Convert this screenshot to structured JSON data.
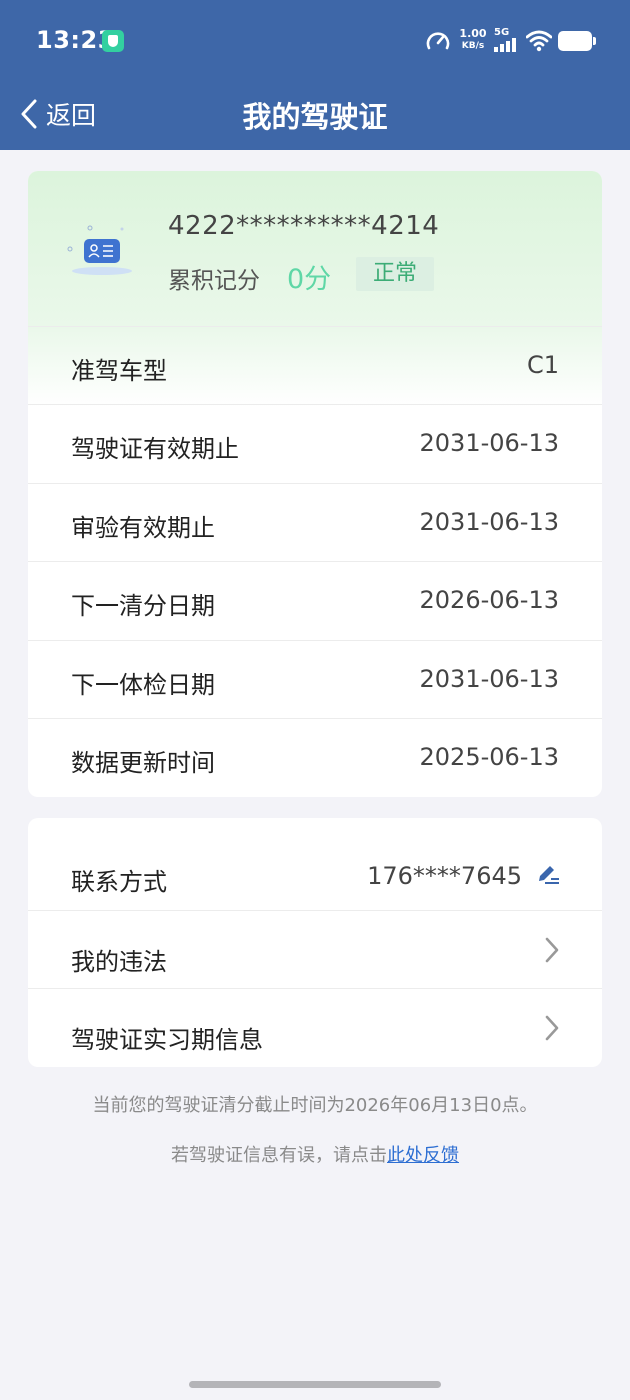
{
  "status_bar": {
    "time": "13:23",
    "speed_value": "1.00",
    "speed_unit": "KB/s",
    "network": "5G"
  },
  "nav": {
    "back_label": "返回",
    "title": "我的驾驶证"
  },
  "license": {
    "number": "4222**********4214",
    "points_label": "累积记分",
    "points_value": "0分",
    "status": "正常",
    "rows": [
      {
        "label": "准驾车型",
        "value": "C1"
      },
      {
        "label": "驾驶证有效期止",
        "value": "2031-06-13"
      },
      {
        "label": "审验有效期止",
        "value": "2031-06-13"
      },
      {
        "label": "下一清分日期",
        "value": "2026-06-13"
      },
      {
        "label": "下一体检日期",
        "value": "2031-06-13"
      },
      {
        "label": "数据更新时间",
        "value": "2025-06-13"
      }
    ]
  },
  "links": {
    "contact_label": "联系方式",
    "contact_value": "176****7645",
    "violations_label": "我的违法",
    "probation_label": "驾驶证实习期信息"
  },
  "footer": {
    "notice": "当前您的驾驶证清分截止时间为2026年06月13日0点。",
    "feedback_prefix": "若驾驶证信息有误，请点击",
    "feedback_link": "此处反馈"
  },
  "colors": {
    "header": "#3e67a8",
    "points": "#5fd7a6",
    "status_badge_text": "#3cac76",
    "link": "#2d6ed2"
  }
}
